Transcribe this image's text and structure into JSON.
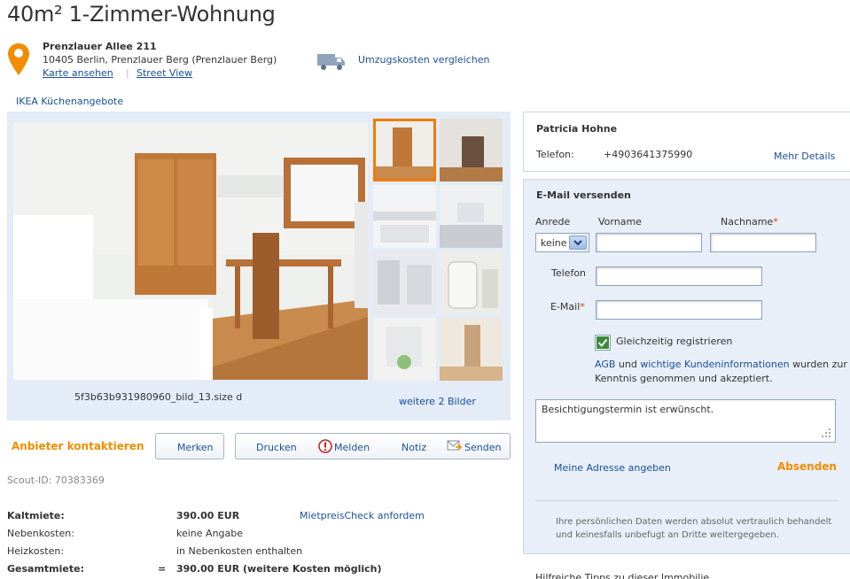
{
  "title": "40m² 1-Zimmer-Wohnung",
  "address": {
    "street": "Prenzlauer Allee 211",
    "city": "10405 Berlin, Prenzlauer Berg (Prenzlauer Berg)",
    "map_link": "Karte ansehen",
    "separator": "|",
    "street_view": "Street View"
  },
  "moving": {
    "icon": "truck-icon",
    "label": "Umzugskosten vergleichen"
  },
  "ikea_link": "IKEA Küchenangebote",
  "gallery": {
    "caption": "5f3b63b931980960_bild_13.size d",
    "more_link": "weitere 2 Bilder",
    "thumbnails": [
      "thumb-1",
      "thumb-2",
      "thumb-3",
      "thumb-4",
      "thumb-5",
      "thumb-6",
      "thumb-7",
      "thumb-8"
    ],
    "selected_index": 0
  },
  "actions": {
    "contact": "Anbieter kontaktieren",
    "merken": "Merken",
    "drucken": "Drucken",
    "melden": "Melden",
    "notiz": "Notiz",
    "senden": "Senden"
  },
  "scout_id": "Scout-ID: 70383369",
  "prices": {
    "kaltmiete_label": "Kaltmiete:",
    "kaltmiete_value": "390.00 EUR",
    "mietpreis_link": "MietpreisCheck anfordem",
    "nebenkosten_label": "Nebenkosten:",
    "nebenkosten_value": "keine Angabe",
    "heizkosten_label": "Heizkosten:",
    "heizkosten_value": "in Nebenkosten enthalten",
    "gesamt_label": "Gesamtmiete:",
    "gesamt_eq": "=",
    "gesamt_value": "390.00 EUR (weitere Kosten möglich)"
  },
  "agent": {
    "name": "Patricia Hohne",
    "phone_label": "Telefon:",
    "phone_value": "+4903641375990",
    "more_details": "Mehr Details"
  },
  "email_form": {
    "title": "E-Mail versenden",
    "anrede_label": "Anrede",
    "anrede_value": "keine",
    "vorname_label": "Vorname",
    "nachname_label": "Nachname",
    "telefon_label": "Telefon",
    "email_label": "E-Mail",
    "required_mark": "*",
    "register_label": "Gleichzeitig registrieren",
    "register_checked": true,
    "agb_link": "AGB",
    "agb_und": "und",
    "kunden_link": "wichtige Kundeninformationen",
    "agb_rest": "wurden zur Kenntnis genommen und akzeptiert.",
    "message": "Besichtigungstermin ist erwünscht.",
    "my_address": "Meine Adresse angeben",
    "submit": "Absenden",
    "privacy": "Ihre persönlichen Daten werden absolut vertraulich behandelt und keinesfalls unbefugt an Dritte weitergegeben."
  },
  "colors": {
    "accent": "#f28c00",
    "link": "#1a4f9c",
    "panel": "#e3ecf7"
  },
  "tipps": "Hilfreiche Tipps zu dieser Immobilie"
}
